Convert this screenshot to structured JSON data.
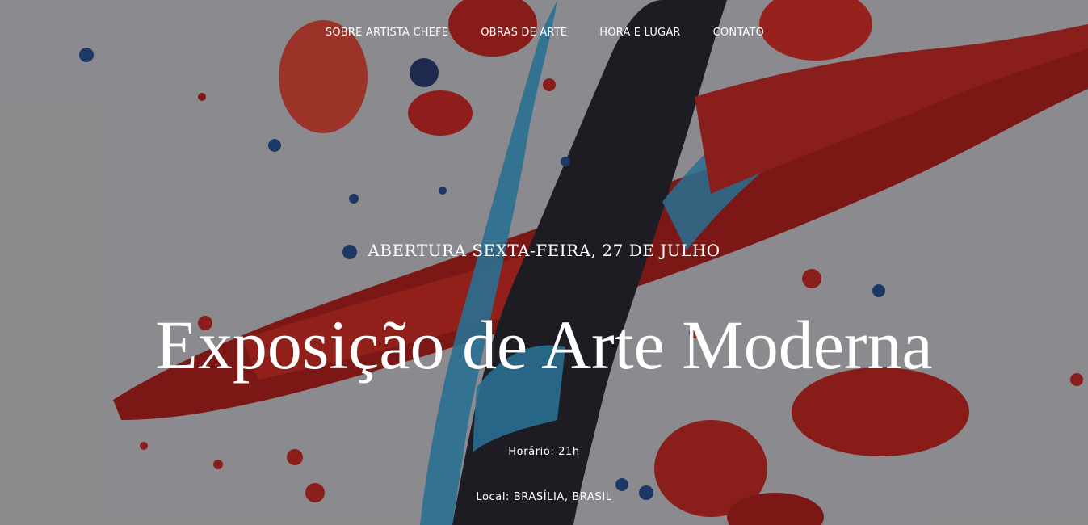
{
  "nav": {
    "items": [
      {
        "label": "SOBRE ARTISTA CHEFE"
      },
      {
        "label": "OBRAS DE ARTE"
      },
      {
        "label": "HORA E LUGAR"
      },
      {
        "label": "CONTATO"
      }
    ]
  },
  "hero": {
    "kicker": "ABERTURA SEXTA-FEIRA, 27 DE JULHO",
    "title": "Exposição de Arte Moderna",
    "time": "Horário: 21h",
    "place": "Local: BRASÍLIA, BRASIL"
  },
  "colors": {
    "background": "#9c9c9f",
    "paint_red": "#9e1a14",
    "paint_blue": "#2a7fa8",
    "paint_dark": "#1c1a22",
    "text": "#ffffff"
  }
}
